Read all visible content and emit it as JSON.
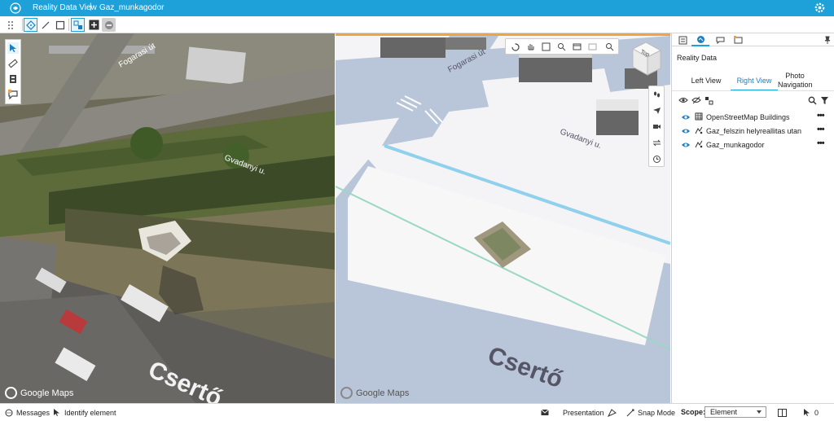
{
  "app": {
    "title": "Reality Data View",
    "separator": "|",
    "project": "Gaz_munkagodor"
  },
  "colors": {
    "brand": "#1ea0d8",
    "accent_tab": "#1a7fc1",
    "view_highlight": "#f2a340"
  },
  "toolbar": {
    "items": [
      "drag-handle-icon",
      "select-tool-icon",
      "line-tool-icon",
      "rectangle-tool-icon",
      "snapping-icon",
      "add-icon",
      "remove-icon"
    ]
  },
  "left_view": {
    "attribution": "Google Maps",
    "map_labels": [
      "Fogarasi út",
      "Gvadanyi u.",
      "Csertő"
    ],
    "tools": [
      "select-icon",
      "measure-icon",
      "clash-icon",
      "comment-icon"
    ]
  },
  "right_view": {
    "attribution": "Google Maps",
    "map_labels": [
      "Fogarasi út",
      "Gvadanyi u.",
      "Csertő"
    ],
    "nav_tools": [
      "rotate-icon",
      "pan-icon",
      "fit-view-icon",
      "zoom-icon",
      "window-area-icon",
      "undo-view-icon",
      "magnify-icon"
    ],
    "cube_face": "Top",
    "vertical_tools": [
      "walk-icon",
      "fly-icon",
      "camera-icon",
      "toggle-icon",
      "clock-icon"
    ]
  },
  "panel": {
    "tabs": [
      "properties-icon",
      "reality-data-icon",
      "comments-icon",
      "image-icon"
    ],
    "title": "Reality Data",
    "view_tabs": [
      {
        "label": "Left View",
        "active": false
      },
      {
        "label": "Right View",
        "active": true
      },
      {
        "label": "Photo Navigation",
        "active": false
      }
    ],
    "layers": [
      {
        "name": "OpenStreetMap Buildings",
        "type_icon": "buildings-icon"
      },
      {
        "name": "Gaz_felszin helyreallitas utan",
        "type_icon": "reality-mesh-icon"
      },
      {
        "name": "Gaz_munkagodor",
        "type_icon": "reality-mesh-icon"
      }
    ],
    "more": "•••"
  },
  "statusbar": {
    "messages": "Messages",
    "identify": "Identify element",
    "presentation": "Presentation",
    "snap_mode": "Snap Mode",
    "scope_label": "Scope:",
    "scope_value": "Element",
    "selection_count": "0"
  }
}
